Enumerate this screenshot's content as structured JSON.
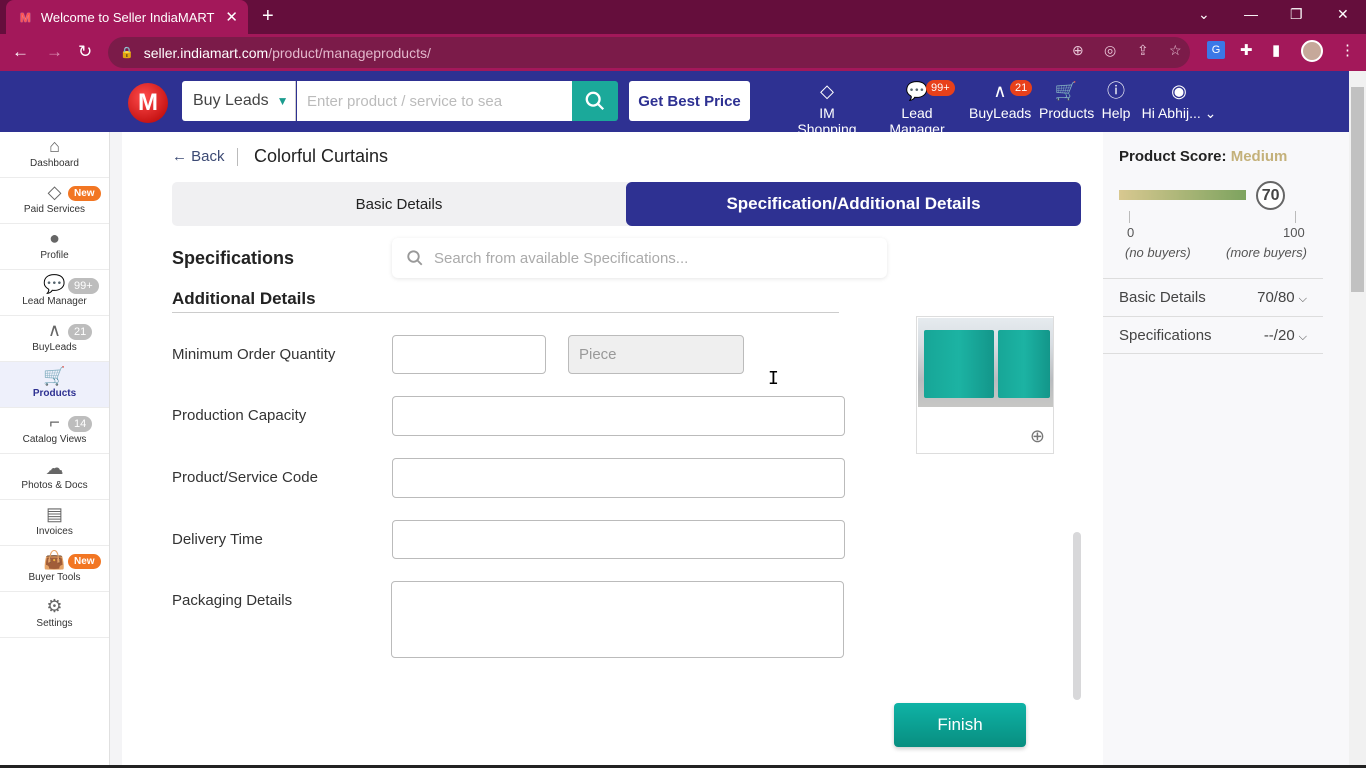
{
  "browser": {
    "tab_title": "Welcome to Seller IndiaMART",
    "favicon": "M",
    "url_host": "seller.indiamart.com",
    "url_path": "/product/manageproducts/",
    "icons": [
      "back-icon",
      "forward-icon",
      "reload-icon",
      "lock-icon",
      "zoom-icon",
      "eye-off-icon",
      "share-icon",
      "star-icon",
      "translate-icon",
      "extensions-icon",
      "sidepanel-icon",
      "profile-avatar",
      "menu-icon"
    ]
  },
  "header": {
    "logo": "M",
    "category": "Buy Leads",
    "search_placeholder": "Enter product / service to sea",
    "get_best_price": "Get Best Price",
    "nav": [
      {
        "label": "IM Shopping",
        "icon": "tag-icon"
      },
      {
        "label": "Lead Manager",
        "icon": "chat-icon",
        "badge": "99+"
      },
      {
        "label": "BuyLeads",
        "icon": "graph-icon",
        "badge": "21"
      },
      {
        "label": "Products",
        "icon": "cart-icon"
      },
      {
        "label": "Help",
        "icon": "help-icon"
      },
      {
        "label": "Hi Abhij...",
        "icon": "user-icon"
      }
    ]
  },
  "sidebar": {
    "items": [
      {
        "label": "Dashboard",
        "icon": "home-icon"
      },
      {
        "label": "Paid Services",
        "icon": "diamond-icon",
        "badge": "New"
      },
      {
        "label": "Profile",
        "icon": "profile-icon"
      },
      {
        "label": "Lead Manager",
        "icon": "chat-icon",
        "badge": "99+"
      },
      {
        "label": "BuyLeads",
        "icon": "graph-icon",
        "badge": "21"
      },
      {
        "label": "Products",
        "icon": "cart-icon",
        "active": true
      },
      {
        "label": "Catalog Views",
        "icon": "stairs-icon",
        "badge": "14"
      },
      {
        "label": "Photos & Docs",
        "icon": "cloud-upload-icon"
      },
      {
        "label": "Invoices",
        "icon": "invoice-icon"
      },
      {
        "label": "Buyer Tools",
        "icon": "bag-icon",
        "badge": "New"
      },
      {
        "label": "Settings",
        "icon": "gear-icon"
      }
    ]
  },
  "main": {
    "back_label": "Back",
    "product_title": "Colorful Curtains",
    "tabs": [
      {
        "label": "Basic Details",
        "active": false
      },
      {
        "label": "Specification/Additional Details",
        "active": true
      }
    ],
    "specifications_heading": "Specifications",
    "spec_search_placeholder": "Search from available Specifications...",
    "additional_heading": "Additional Details",
    "fields": {
      "moq_label": "Minimum Order Quantity",
      "moq_value": "",
      "moq_unit": "Piece",
      "production_capacity_label": "Production Capacity",
      "production_capacity_value": "",
      "product_code_label": "Product/Service Code",
      "product_code_value": "",
      "delivery_time_label": "Delivery Time",
      "delivery_time_value": "",
      "packaging_label": "Packaging Details",
      "packaging_value": ""
    },
    "finish_label": "Finish"
  },
  "score_panel": {
    "title": "Product Score:",
    "level": "Medium",
    "level_color": "#c4b17a",
    "score": "70",
    "score_fraction": 0.7,
    "min_label": "0",
    "min_caption": "(no buyers)",
    "max_label": "100",
    "max_caption": "(more buyers)",
    "rows": [
      {
        "label": "Basic Details",
        "value": "70/80"
      },
      {
        "label": "Specifications",
        "value": "--/20"
      }
    ]
  }
}
